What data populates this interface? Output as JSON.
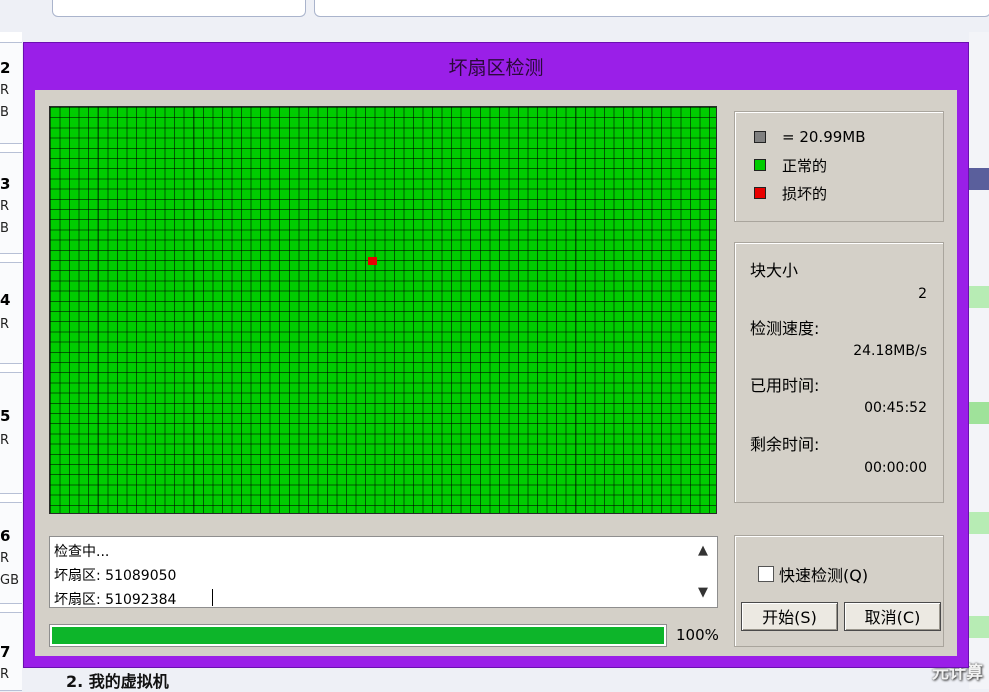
{
  "background": {
    "rows": [
      {
        "num": "2",
        "lines": [
          "R",
          "B"
        ]
      },
      {
        "num": "3",
        "lines": [
          "R",
          "B"
        ]
      },
      {
        "num": "4",
        "lines": [
          "R"
        ]
      },
      {
        "num": "5",
        "lines": [
          "R"
        ]
      },
      {
        "num": "6",
        "lines": [
          "R",
          "GB"
        ]
      },
      {
        "num": "7",
        "lines": [
          "R"
        ]
      }
    ],
    "bottom_text": "2. 我的虚拟机",
    "watermark": "元计算"
  },
  "dialog": {
    "title": "坏扇区检测",
    "legend": {
      "block_label": "= 20.99MB",
      "normal_label": "正常的",
      "damaged_label": "损坏的",
      "colors": {
        "block": "#808080",
        "normal": "#00cc00",
        "damaged": "#e80000"
      }
    },
    "stats": {
      "block_size_label": "块大小",
      "block_size_value": "2",
      "speed_label": "检测速度:",
      "speed_value": "24.18MB/s",
      "elapsed_label": "已用时间:",
      "elapsed_value": "00:45:52",
      "remaining_label": "剩余时间:",
      "remaining_value": "00:00:00"
    },
    "log_lines": [
      "检查中...",
      "坏扇区: 51089050",
      "坏扇区: 51092384"
    ],
    "progress": {
      "percent": 100,
      "text": "100%"
    },
    "quick_check_label": "快速检测(Q)",
    "quick_check_checked": false,
    "start_button": "开始(S)",
    "cancel_button": "取消(C)",
    "sector_colors": {
      "normal": "#00cc00",
      "damaged": "#e80000"
    }
  }
}
